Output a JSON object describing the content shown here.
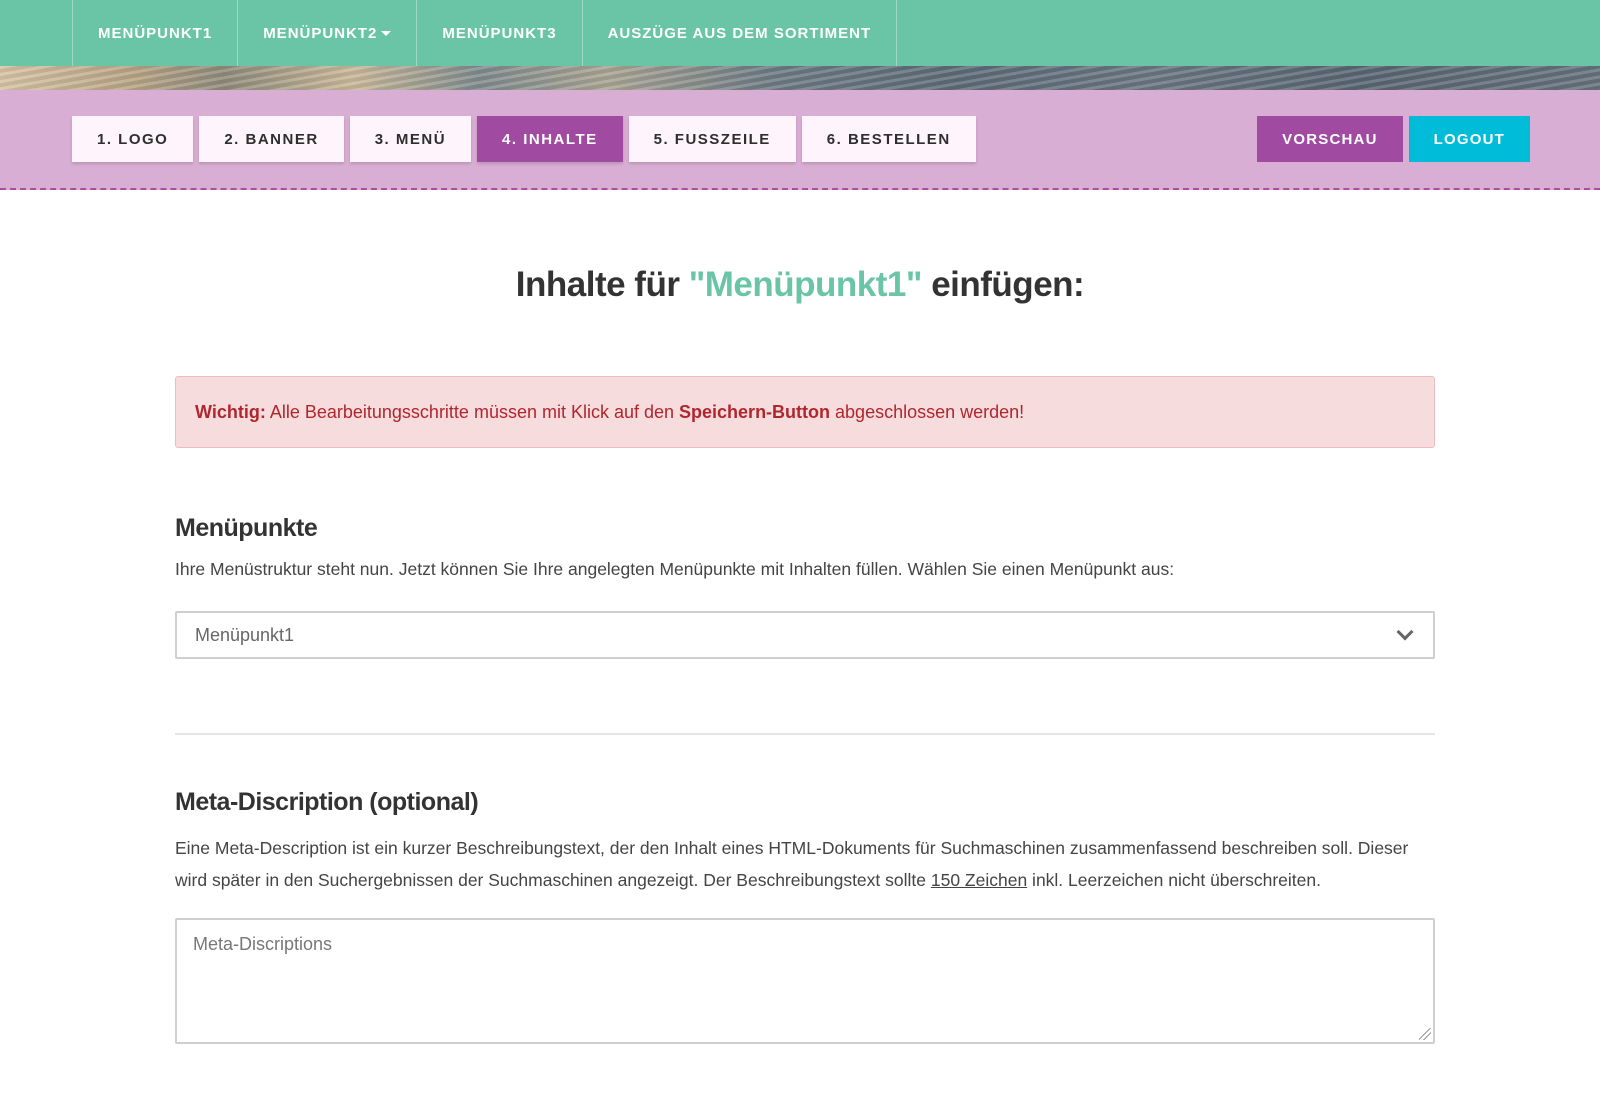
{
  "topnav": {
    "items": [
      {
        "label": "MENÜPUNKT1"
      },
      {
        "label": "MENÜPUNKT2"
      },
      {
        "label": "MENÜPUNKT3"
      },
      {
        "label": "AUSZÜGE AUS DEM SORTIMENT"
      }
    ]
  },
  "steps": [
    {
      "label": "1. LOGO"
    },
    {
      "label": "2. BANNER"
    },
    {
      "label": "3. MENÜ"
    },
    {
      "label": "4. INHALTE",
      "active": true
    },
    {
      "label": "5. FUSSZEILE"
    },
    {
      "label": "6. BESTELLEN"
    }
  ],
  "actions": {
    "preview": "VORSCHAU",
    "logout": "LOGOUT"
  },
  "title": {
    "prefix": "Inhalte für ",
    "accent": "\"Menüpunkt1\"",
    "suffix": " einfügen:"
  },
  "alert": {
    "strong": "Wichtig:",
    "text1": " Alle Bearbeitungsschritte müssen mit Klick auf den ",
    "strong2": "Speichern-Button",
    "text2": " abgeschlossen werden!"
  },
  "menu_section": {
    "heading": "Menüpunkte",
    "description": "Ihre Menüstruktur steht nun. Jetzt können Sie Ihre angelegten Menüpunkte mit Inhalten füllen. Wählen Sie einen Menüpunkt aus:",
    "selected": "Menüpunkt1"
  },
  "meta_section": {
    "heading": "Meta-Discription (optional)",
    "desc1": "Eine Meta-Description ist ein kurzer Beschreibungstext, der den Inhalt eines HTML-Dokuments für Suchmaschinen zusammenfassend beschreiben soll. Dieser wird später in den Suchergebnissen der Suchmaschinen angezeigt. Der Beschreibungstext sollte ",
    "link": "150 Zeichen",
    "desc2": " inkl. Leerzeichen nicht überschreiten.",
    "placeholder": "Meta-Discriptions"
  },
  "colors": {
    "topnav": "#6ac5a6",
    "editorbar": "#d9aed4",
    "active_step": "#a04aa2",
    "logout": "#00bcd9",
    "alert_text": "#b0262e"
  }
}
